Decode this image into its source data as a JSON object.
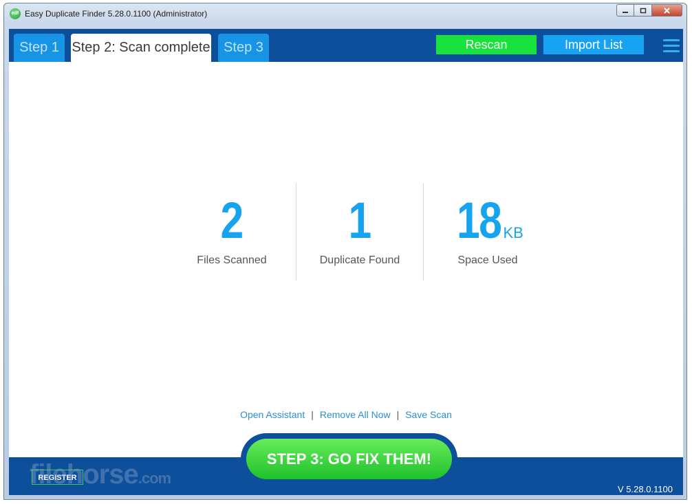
{
  "window": {
    "title": "Easy Duplicate Finder 5.28.0.1100 (Administrator)",
    "app_icon_text": "edf"
  },
  "header": {
    "tabs": [
      {
        "label": "Step 1",
        "active": false
      },
      {
        "label": "Step 2: Scan complete",
        "active": true
      },
      {
        "label": "Step 3",
        "active": false
      }
    ],
    "rescan_label": "Rescan",
    "import_label": "Import  List"
  },
  "stats": [
    {
      "value": "2",
      "unit": "",
      "label": "Files Scanned"
    },
    {
      "value": "1",
      "unit": "",
      "label": "Duplicate Found"
    },
    {
      "value": "18",
      "unit": "KB",
      "label": "Space Used"
    }
  ],
  "links": {
    "open_assistant": "Open Assistant",
    "remove_all": "Remove All Now",
    "save_scan": "Save Scan",
    "separator": "|"
  },
  "footer": {
    "go_button": "STEP 3: GO FIX THEM!",
    "register": "REGISTER",
    "version": "V 5.28.0.1100",
    "watermark": "filehorse",
    "watermark_suffix": ".com"
  },
  "colors": {
    "header_bg": "#0e4f9c",
    "accent_blue": "#16a4ee",
    "rescan_green": "#18e23c",
    "import_blue": "#18a3f2",
    "go_green": "#1ec12b"
  }
}
